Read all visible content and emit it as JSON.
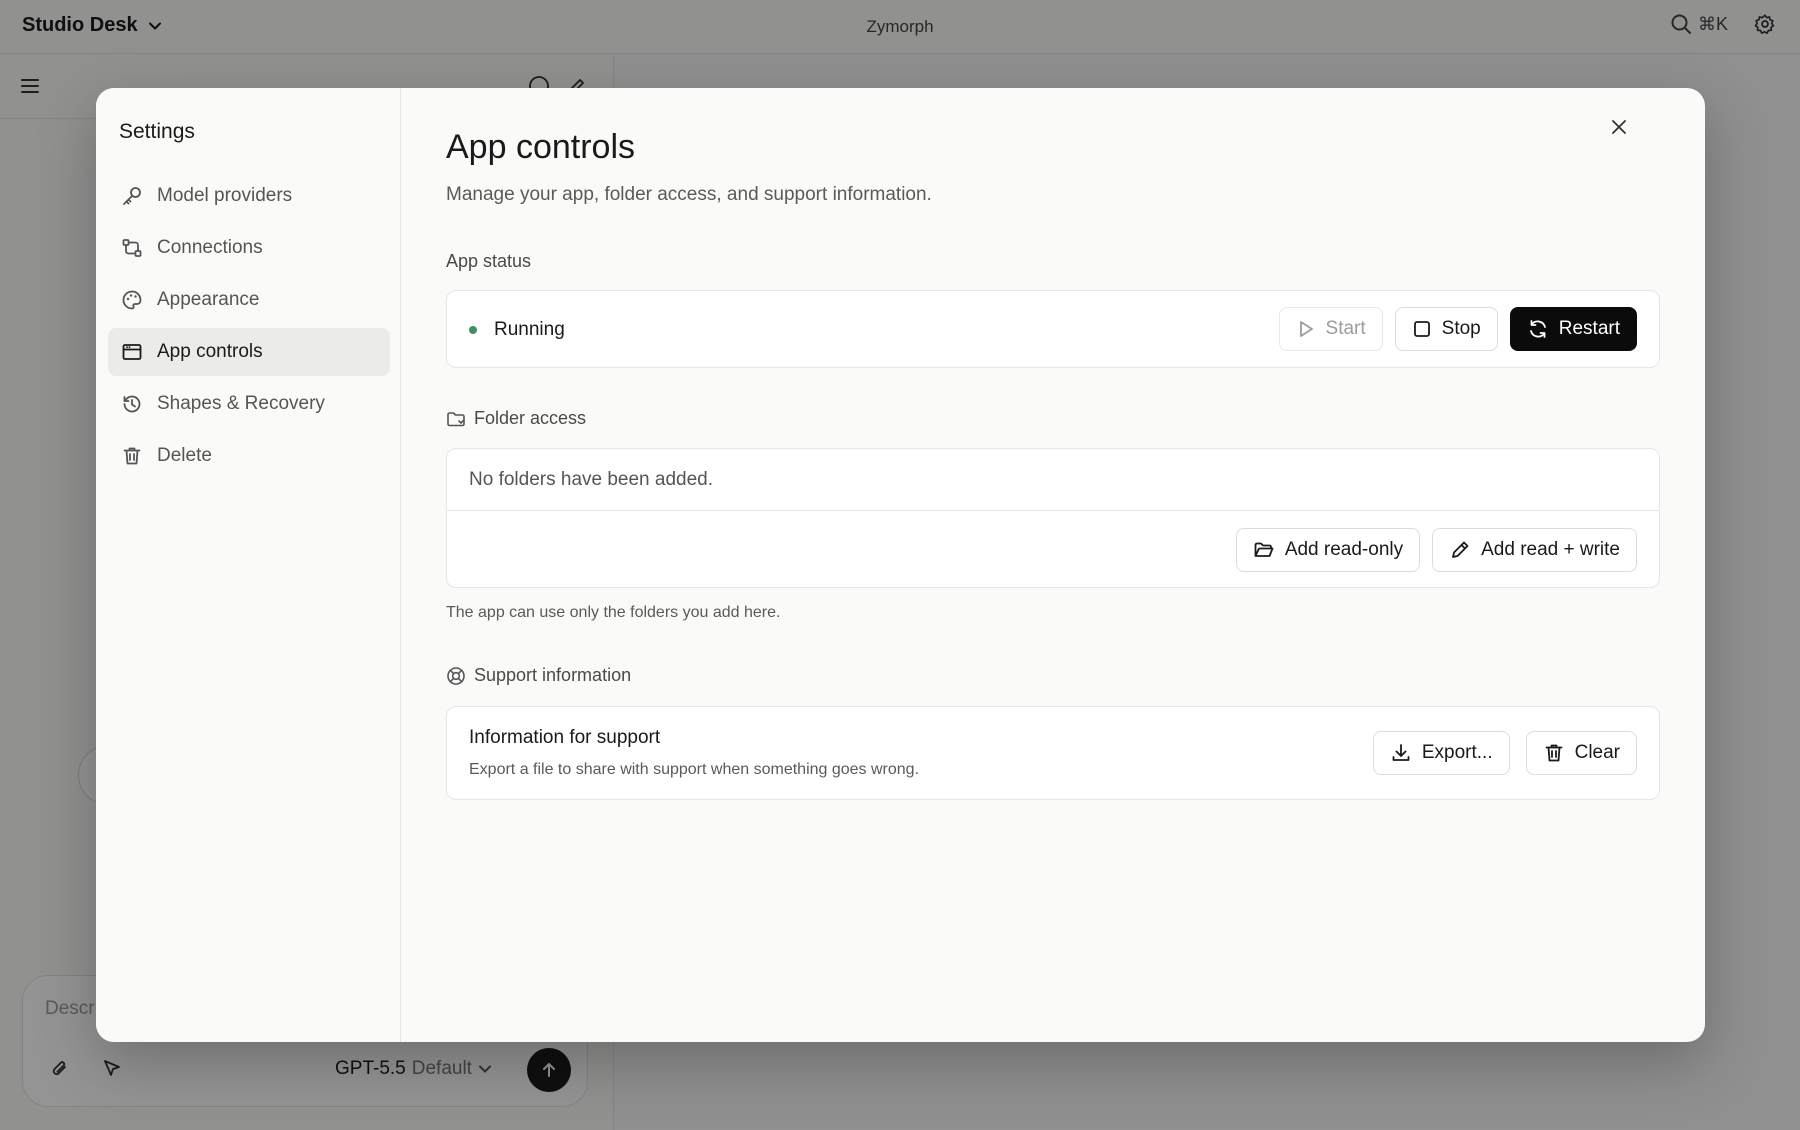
{
  "app": {
    "workspace": "Studio Desk",
    "title": "Zymorph",
    "search_shortcut": "⌘K"
  },
  "composer": {
    "placeholder": "Descr",
    "model": "GPT-5.5",
    "model_variant": "Default"
  },
  "settings": {
    "title": "Settings",
    "nav": [
      {
        "label": "Model providers",
        "icon": "key-icon"
      },
      {
        "label": "Connections",
        "icon": "connections-icon"
      },
      {
        "label": "Appearance",
        "icon": "palette-icon"
      },
      {
        "label": "App controls",
        "icon": "window-icon",
        "active": true
      },
      {
        "label": "Shapes & Recovery",
        "icon": "history-icon"
      },
      {
        "label": "Delete",
        "icon": "trash-icon"
      }
    ],
    "page": {
      "title": "App controls",
      "subtitle": "Manage your app, folder access, and support information.",
      "status": {
        "label": "App status",
        "state": "Running",
        "state_color": "#3f8f63",
        "start": "Start",
        "stop": "Stop",
        "restart": "Restart"
      },
      "folders": {
        "label": "Folder access",
        "empty": "No folders have been added.",
        "add_read_only": "Add read-only",
        "add_read_write": "Add read + write",
        "note": "The app can use only the folders you add here."
      },
      "support": {
        "label": "Support information",
        "title": "Information for support",
        "description": "Export a file to share with support when something goes wrong.",
        "export": "Export...",
        "clear": "Clear"
      }
    }
  }
}
